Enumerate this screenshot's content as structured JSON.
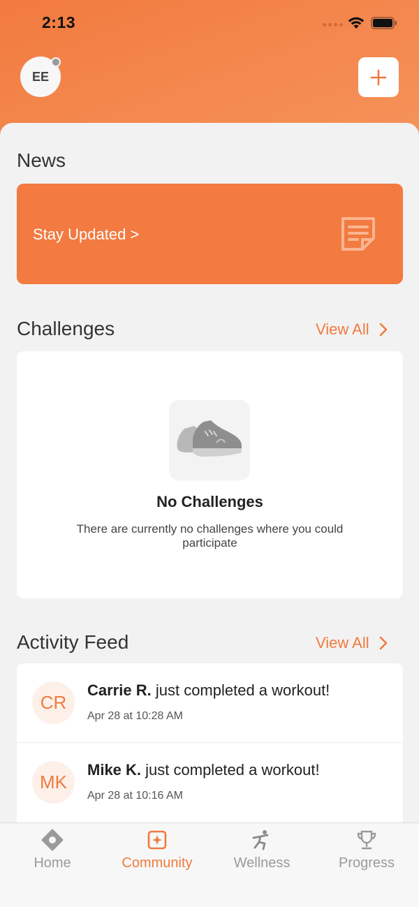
{
  "status_bar": {
    "time": "2:13"
  },
  "header": {
    "avatar_initials": "EE"
  },
  "news": {
    "title": "News",
    "card_label": "Stay Updated >"
  },
  "challenges": {
    "title": "Challenges",
    "view_all": "View All",
    "empty_title": "No Challenges",
    "empty_description": "There are currently no challenges where you could participate"
  },
  "activity_feed": {
    "title": "Activity Feed",
    "view_all": "View All",
    "items": [
      {
        "initials": "CR",
        "name": "Carrie R.",
        "action": "just completed a workout!",
        "time": "Apr 28 at 10:28 AM"
      },
      {
        "initials": "MK",
        "name": "Mike K.",
        "action": "just completed a workout!",
        "time": "Apr 28 at 10:16 AM"
      }
    ]
  },
  "tabs": [
    {
      "label": "Home",
      "icon": "home-icon",
      "active": false
    },
    {
      "label": "Community",
      "icon": "community-icon",
      "active": true
    },
    {
      "label": "Wellness",
      "icon": "wellness-icon",
      "active": false
    },
    {
      "label": "Progress",
      "icon": "trophy-icon",
      "active": false
    }
  ],
  "colors": {
    "accent": "#f07a3e",
    "header_start": "#f27a3f",
    "header_end": "#f5955c",
    "sheet_bg": "#f2f2f2"
  }
}
